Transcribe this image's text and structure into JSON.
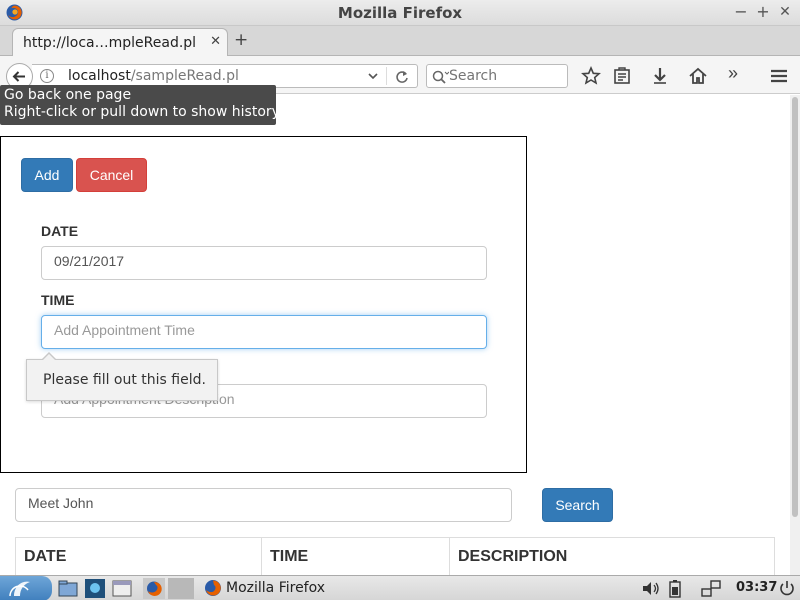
{
  "window": {
    "title": "Mozilla Firefox",
    "minimize": "−",
    "maximize": "+",
    "close": "✕"
  },
  "tabs": [
    {
      "label": "http://loca…mpleRead.pl",
      "close": "✕"
    }
  ],
  "new_tab": "+",
  "nav": {
    "url_host": "localhost",
    "url_path": "/sampleRead.pl",
    "info": "i",
    "search_placeholder": "Search",
    "overflow": "»"
  },
  "tooltip": {
    "line1": "Go back one page",
    "line2": "Right-click or pull down to show history"
  },
  "form": {
    "add_label": "Add",
    "cancel_label": "Cancel",
    "date_label": "DATE",
    "date_value": "09/21/2017",
    "time_label": "TIME",
    "time_placeholder": "Add Appointment Time",
    "description_placeholder": "Add Appointment Description",
    "validation_message": "Please fill out this field."
  },
  "search": {
    "value": "Meet John",
    "button_label": "Search"
  },
  "table": {
    "headers": [
      "DATE",
      "TIME",
      "DESCRIPTION"
    ]
  },
  "taskbar": {
    "task_label": "Mozilla Firefox",
    "clock": "03:37"
  },
  "colors": {
    "primary": "#337ab7",
    "danger": "#d9534f",
    "focus": "#66afe9",
    "tooltip_bg": "#4a4a4a"
  }
}
